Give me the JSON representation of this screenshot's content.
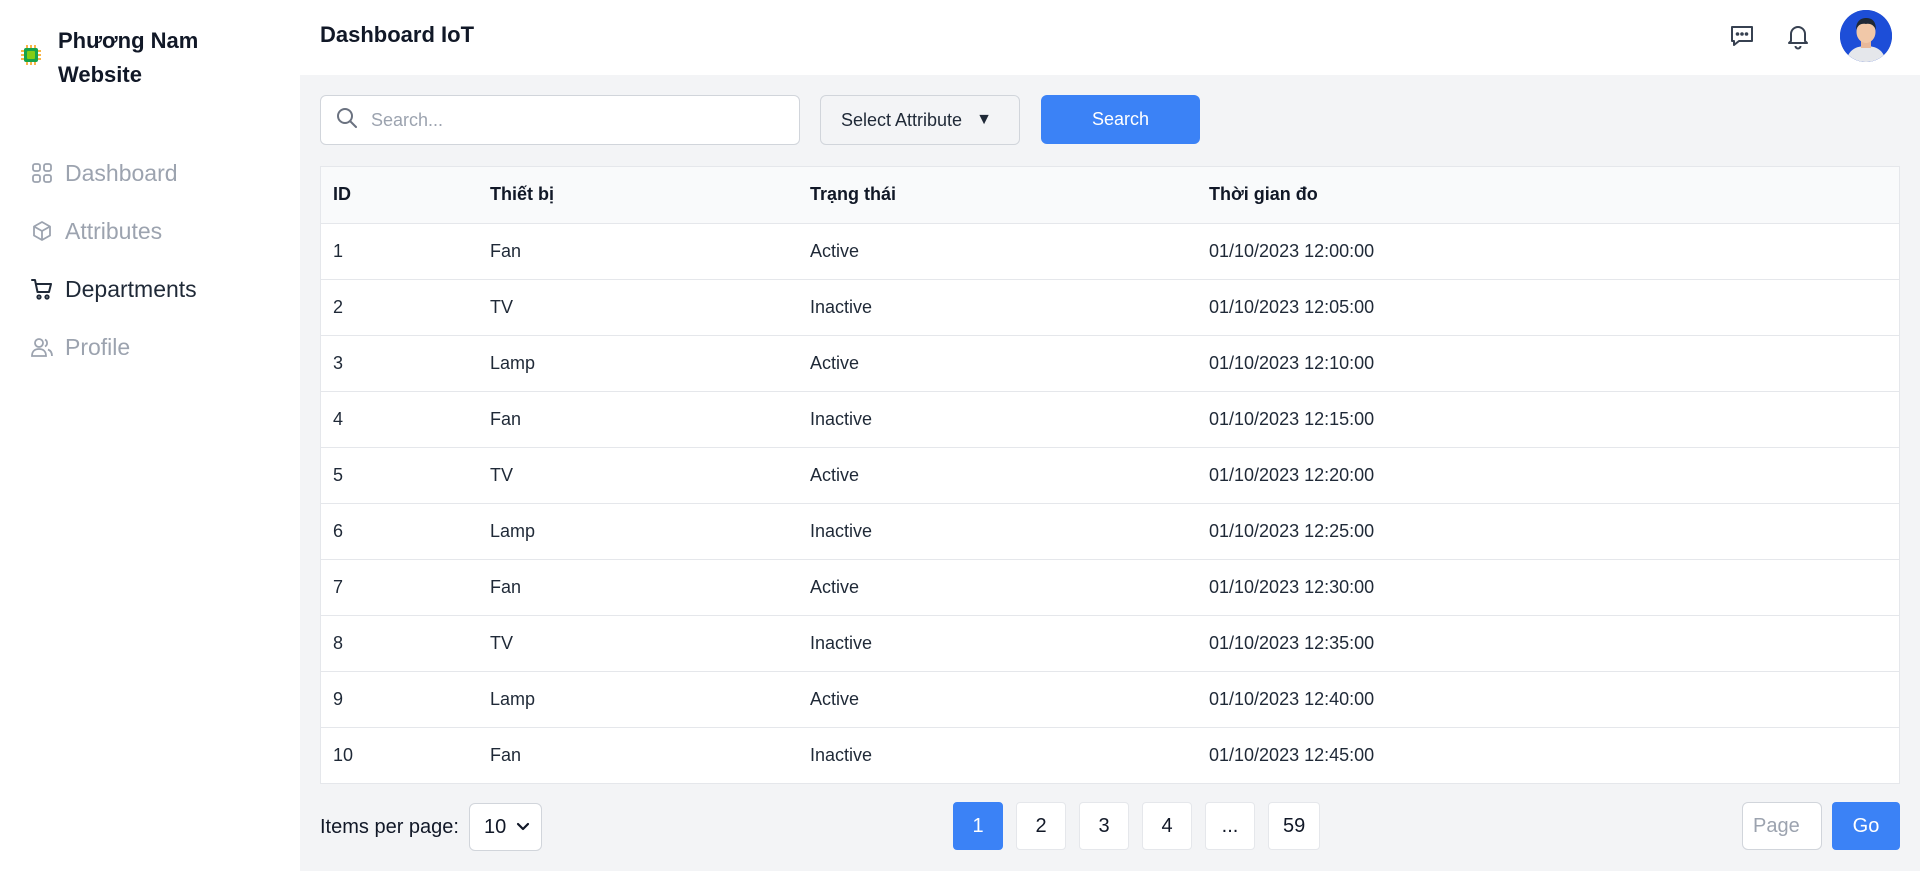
{
  "brand": {
    "title": "Phương Nam Website",
    "icon": "chip-icon",
    "accent": "#22c55e"
  },
  "sidebar": {
    "items": [
      {
        "label": "Dashboard",
        "icon": "grid-icon",
        "active": false
      },
      {
        "label": "Attributes",
        "icon": "cube-icon",
        "active": false
      },
      {
        "label": "Departments",
        "icon": "cart-icon",
        "active": true
      },
      {
        "label": "Profile",
        "icon": "users-icon",
        "active": false
      }
    ]
  },
  "header": {
    "title": "Dashboard IoT",
    "icons": [
      "chat-icon",
      "bell-icon"
    ]
  },
  "search": {
    "placeholder": "Search...",
    "value": ""
  },
  "filter": {
    "label": "Select Attribute",
    "caret": "▼"
  },
  "search_button": "Search",
  "table": {
    "columns": [
      "ID",
      "Thiết bị",
      "Trạng thái",
      "Thời gian đo"
    ],
    "rows": [
      [
        "1",
        "Fan",
        "Active",
        "01/10/2023 12:00:00"
      ],
      [
        "2",
        "TV",
        "Inactive",
        "01/10/2023 12:05:00"
      ],
      [
        "3",
        "Lamp",
        "Active",
        "01/10/2023 12:10:00"
      ],
      [
        "4",
        "Fan",
        "Inactive",
        "01/10/2023 12:15:00"
      ],
      [
        "5",
        "TV",
        "Active",
        "01/10/2023 12:20:00"
      ],
      [
        "6",
        "Lamp",
        "Inactive",
        "01/10/2023 12:25:00"
      ],
      [
        "7",
        "Fan",
        "Active",
        "01/10/2023 12:30:00"
      ],
      [
        "8",
        "TV",
        "Inactive",
        "01/10/2023 12:35:00"
      ],
      [
        "9",
        "Lamp",
        "Active",
        "01/10/2023 12:40:00"
      ],
      [
        "10",
        "Fan",
        "Inactive",
        "01/10/2023 12:45:00"
      ]
    ]
  },
  "pagination": {
    "items_per_page_label": "Items per page:",
    "items_per_page_value": "10",
    "pages": [
      "1",
      "2",
      "3",
      "4",
      "...",
      "59"
    ],
    "current": "1",
    "goto_placeholder": "Page",
    "go_label": "Go"
  },
  "colors": {
    "primary": "#3b82f6",
    "muted": "#9ca3af",
    "surface": "#f3f4f6"
  }
}
